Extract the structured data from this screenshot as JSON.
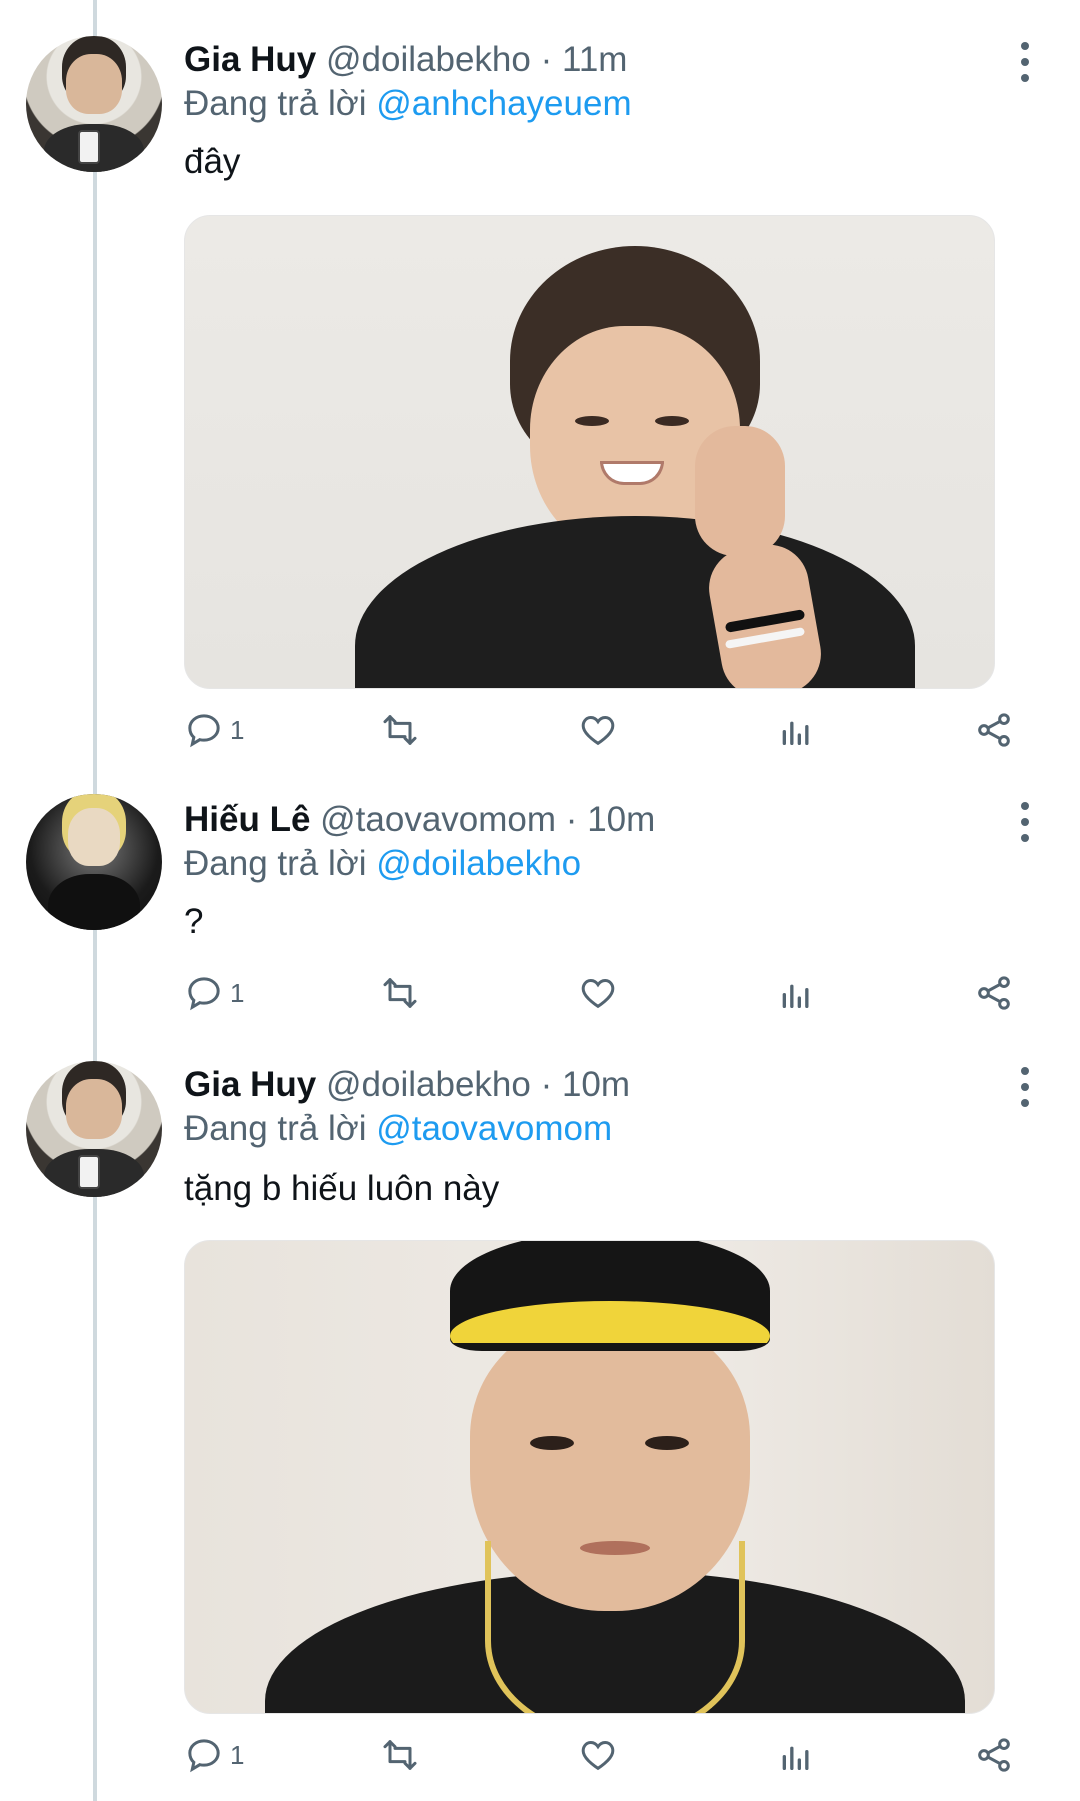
{
  "tweets": [
    {
      "name": "Gia Huy",
      "handle": "@doilabekho",
      "separator": "·",
      "time": "11m",
      "reply_prefix": "Đang trả lời ",
      "reply_to": "@anhchayeuem",
      "text": "đây",
      "has_media": true,
      "reply_count": "1"
    },
    {
      "name": "Hiếu Lê",
      "handle": "@taovavomom",
      "separator": "·",
      "time": "10m",
      "reply_prefix": "Đang trả lời ",
      "reply_to": "@doilabekho",
      "text": "?",
      "has_media": false,
      "reply_count": "1"
    },
    {
      "name": "Gia Huy",
      "handle": "@doilabekho",
      "separator": "·",
      "time": "10m",
      "reply_prefix": "Đang trả lời ",
      "reply_to": "@taovavomom",
      "text": "tặng b hiếu luôn này",
      "has_media": true,
      "reply_count": "1"
    }
  ],
  "colors": {
    "link": "#1d9bf0",
    "muted": "#536471",
    "text": "#0f1419",
    "thread_line": "#cfd9de"
  },
  "icons": [
    "reply-icon",
    "retweet-icon",
    "like-icon",
    "views-icon",
    "share-icon",
    "more-icon"
  ]
}
